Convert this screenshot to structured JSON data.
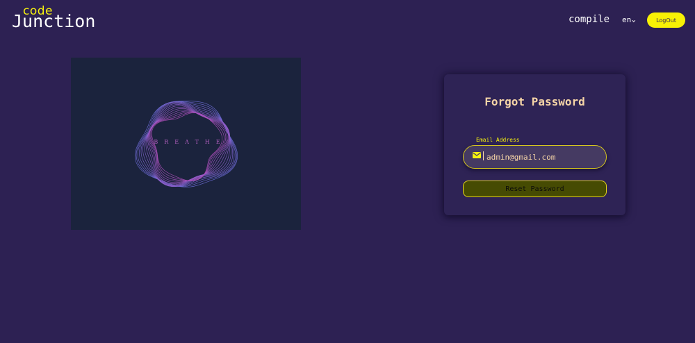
{
  "header": {
    "logo_top": "code",
    "logo_main": "Junction",
    "nav_compile": "compile",
    "language": "en",
    "logout_label": "LogOut"
  },
  "illustration": {
    "text": "BREATHE"
  },
  "form": {
    "title": "Forgot Password",
    "email_label": "Email Address",
    "email_value": "admin@gmail.com",
    "submit_label": "Reset Password"
  },
  "icons": {
    "email": "envelope-icon",
    "language_dropdown": "chevron-down-icon"
  },
  "colors": {
    "background": "#2d2153",
    "accent": "#f5f10f",
    "card_title": "#f6d5a7",
    "illustration_bg": "#1b233d"
  }
}
